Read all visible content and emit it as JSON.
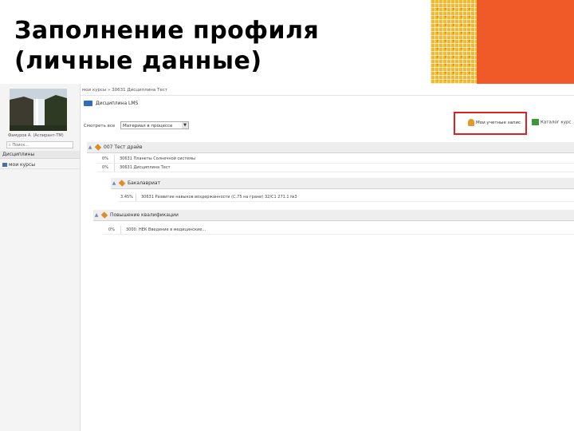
{
  "slide": {
    "title_line1": "Заполнение профиля",
    "title_line2": "(личные данные)"
  },
  "colors": {
    "accent_orange": "#ef5a28",
    "accent_yellow": "#f1b92d",
    "highlight_red": "#e02020"
  },
  "sidebar": {
    "username": "Фамуров А. (Аспирант-ТМ)",
    "search_placeholder": "Поиск...",
    "section_label": "Дисциплины",
    "items": [
      {
        "label": "мои курсы"
      }
    ]
  },
  "main": {
    "breadcrumb": "мои курсы » 30631 Дисциплина Тест",
    "discipline_title": "Дисциплина LMS",
    "filter_label": "Смотреть все",
    "filter_value": "Материал в процессе",
    "toolbar": {
      "profile_label": "Мои учетные запис",
      "catalog_label": "Каталог курс"
    },
    "sections": [
      {
        "title": "007 Тест драйв",
        "rows": [
          {
            "pct": "0%",
            "text": "30631 Планеты Солнечной системы"
          },
          {
            "pct": "0%",
            "text": "30631 Дисциплина Тест"
          }
        ]
      },
      {
        "title": "Бакалавриат",
        "rows": [
          {
            "pct": "3.45%",
            "text": "30631 Развитие навыков воздержанности (С.75 на грани) 32/С1 271.1 №3"
          }
        ]
      },
      {
        "title": "Повышение квалификации",
        "rows": [
          {
            "pct": "0%",
            "text": "3000: НЕК Введение в медицинские..."
          }
        ]
      }
    ]
  }
}
